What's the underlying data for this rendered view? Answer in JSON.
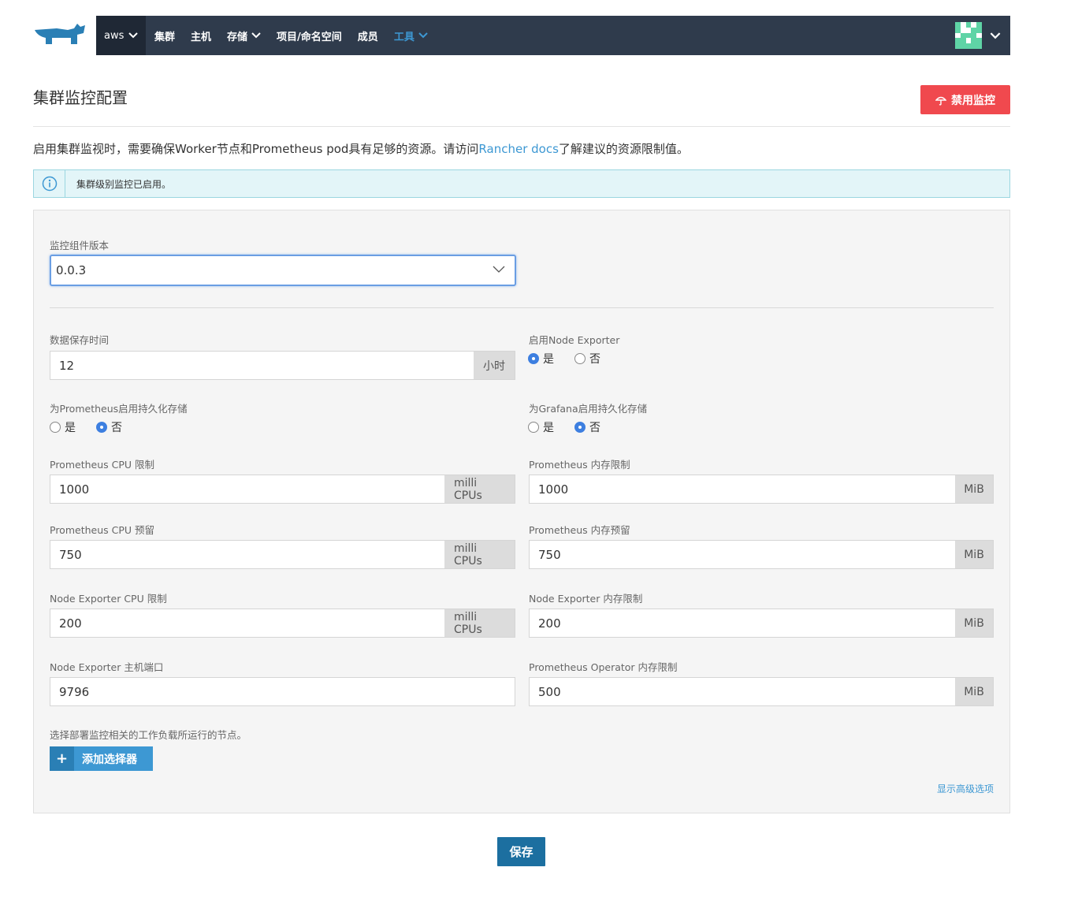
{
  "header": {
    "cluster": "aws",
    "nav": [
      {
        "label": "集群",
        "has_caret": false,
        "active": false
      },
      {
        "label": "主机",
        "has_caret": false,
        "active": false
      },
      {
        "label": "存储",
        "has_caret": true,
        "active": false
      },
      {
        "label": "项目/命名空间",
        "has_caret": false,
        "active": false
      },
      {
        "label": "成员",
        "has_caret": false,
        "active": false
      },
      {
        "label": "工具",
        "has_caret": true,
        "active": true
      }
    ]
  },
  "page": {
    "title": "集群监控配置",
    "disable_button": "禁用监控",
    "description_pre": "启用集群监视时，需要确保Worker节点和Prometheus pod具有足够的资源。请访问",
    "description_link": "Rancher docs",
    "description_post": "了解建议的资源限制值。",
    "banner": "集群级别监控已启用。"
  },
  "form": {
    "version_label": "监控组件版本",
    "version_value": "0.0.3",
    "retention_label": "数据保存时间",
    "retention_value": "12",
    "retention_unit": "小时",
    "node_exporter_label": "启用Node Exporter",
    "node_exporter_yes": "是",
    "node_exporter_no": "否",
    "prom_storage_label": "为Prometheus启用持久化存储",
    "prom_storage_yes": "是",
    "prom_storage_no": "否",
    "grafana_storage_label": "为Grafana启用持久化存储",
    "grafana_storage_yes": "是",
    "grafana_storage_no": "否",
    "prom_cpu_limit_label": "Prometheus CPU 限制",
    "prom_cpu_limit_value": "1000",
    "prom_cpu_limit_unit": "milli CPUs",
    "prom_mem_limit_label": "Prometheus 内存限制",
    "prom_mem_limit_value": "1000",
    "prom_mem_limit_unit": "MiB",
    "prom_cpu_reserve_label": "Prometheus CPU 预留",
    "prom_cpu_reserve_value": "750",
    "prom_cpu_reserve_unit": "milli CPUs",
    "prom_mem_reserve_label": "Prometheus 内存预留",
    "prom_mem_reserve_value": "750",
    "prom_mem_reserve_unit": "MiB",
    "ne_cpu_limit_label": "Node Exporter CPU 限制",
    "ne_cpu_limit_value": "200",
    "ne_cpu_limit_unit": "milli CPUs",
    "ne_mem_limit_label": "Node Exporter 内存限制",
    "ne_mem_limit_value": "200",
    "ne_mem_limit_unit": "MiB",
    "ne_port_label": "Node Exporter 主机端口",
    "ne_port_value": "9796",
    "op_mem_limit_label": "Prometheus Operator 内存限制",
    "op_mem_limit_value": "500",
    "op_mem_limit_unit": "MiB",
    "selector_hint": "选择部署监控相关的工作负载所运行的节点。",
    "add_selector": "添加选择器",
    "advanced": "显示高级选项"
  },
  "footer": {
    "save": "保存"
  },
  "colors": {
    "nav_bg": "#2f3b4c",
    "accent": "#3d98d3",
    "danger": "#f0494e",
    "save": "#1c6fa0"
  }
}
